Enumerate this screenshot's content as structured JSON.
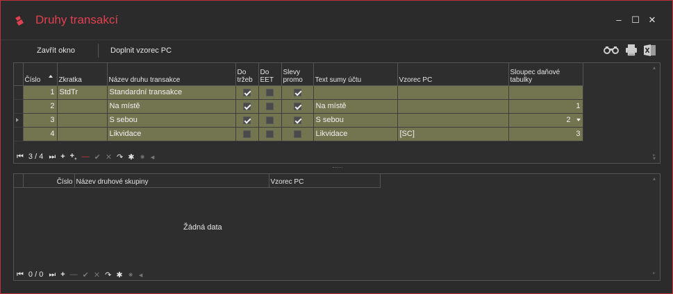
{
  "window": {
    "title": "Druhy transakcí",
    "controls": {
      "minimize": "–",
      "maximize": "☐",
      "close": "✕"
    },
    "accent_color": "#e04150"
  },
  "toolbar": {
    "close_label": "Zavřít okno",
    "fill_label": "Doplnit vzorec PC",
    "icons": [
      "binoculars-icon",
      "printer-icon",
      "excel-icon"
    ]
  },
  "grid1": {
    "columns": {
      "cislo": "Číslo",
      "zkratka": "Zkratka",
      "nazev": "Název druhu transakce",
      "do_trzeb_1": "Do",
      "do_trzeb_2": "tržeb",
      "do_eet_1": "Do",
      "do_eet_2": "EET",
      "slevy_1": "Slevy",
      "slevy_2": "promo",
      "text_sumy": "Text sumy účtu",
      "vzorec": "Vzorec PC",
      "sloupec_1": "Sloupec daňové",
      "sloupec_2": "tabulky"
    },
    "rows": [
      {
        "cislo": "1",
        "zkratka": "StdTr",
        "nazev": "Standardní transakce",
        "do_trzeb": true,
        "do_eet": false,
        "slevy": true,
        "text_sumy": "",
        "vzorec": "",
        "sloupec": ""
      },
      {
        "cislo": "2",
        "zkratka": "",
        "nazev": "Na místě",
        "do_trzeb": true,
        "do_eet": false,
        "slevy": true,
        "text_sumy": "Na místě",
        "vzorec": "",
        "sloupec": "1"
      },
      {
        "cislo": "3",
        "zkratka": "",
        "nazev": "S sebou",
        "do_trzeb": true,
        "do_eet": false,
        "slevy": true,
        "text_sumy": "S sebou",
        "vzorec": "",
        "sloupec": "2"
      },
      {
        "cislo": "4",
        "zkratka": "",
        "nazev": "Likvidace",
        "do_trzeb": false,
        "do_eet": false,
        "slevy": false,
        "text_sumy": "Likvidace",
        "vzorec": "[SC]",
        "sloupec": "3"
      }
    ],
    "nav_counter": "3 / 4",
    "row_color": "#737551"
  },
  "grid2": {
    "columns": {
      "cislo": "Číslo",
      "nazev": "Název druhové skupiny",
      "vzorec": "Vzorec PC"
    },
    "empty_text": "Žádná data",
    "nav_counter": "0 / 0"
  },
  "nav_glyphs": {
    "first": "⏮",
    "last": "⏭",
    "add": "+",
    "delete": "—",
    "confirm": "✔",
    "cancel": "✕",
    "refresh": "↷",
    "filter": "✱",
    "filter_clear": "⁕",
    "left": "◂"
  }
}
